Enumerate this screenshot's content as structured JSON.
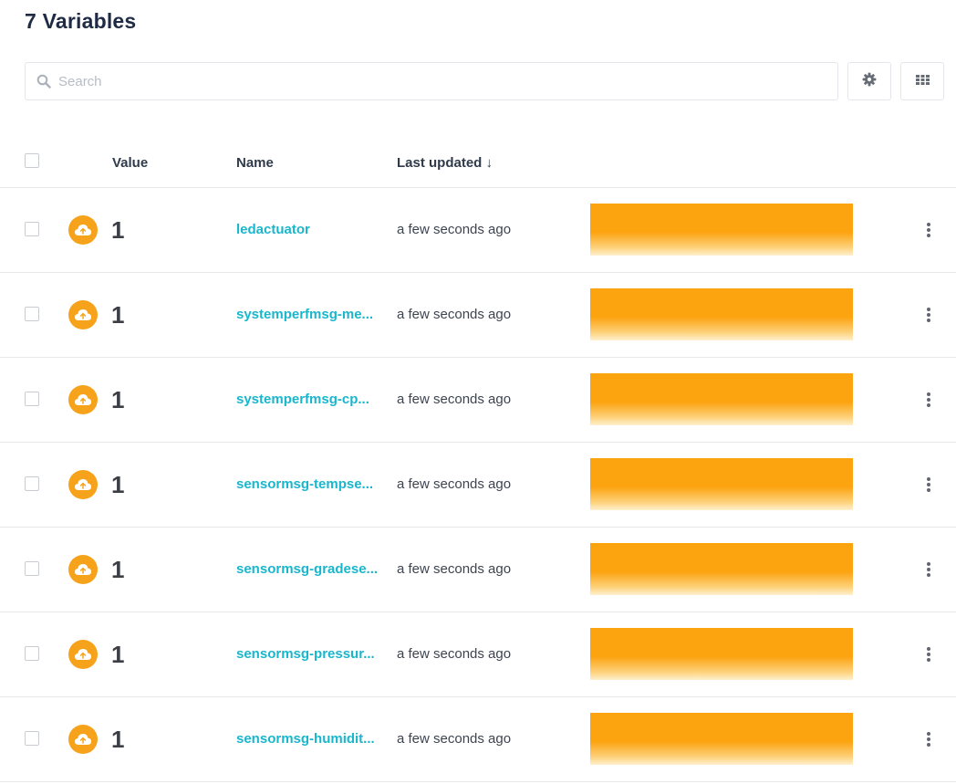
{
  "page": {
    "title": "7 Variables"
  },
  "search": {
    "placeholder": "Search",
    "icon": "search-icon"
  },
  "toolbar": {
    "settings_icon": "gear-icon",
    "grid_icon": "grid-icon"
  },
  "table": {
    "columns": {
      "value": "Value",
      "name": "Name",
      "last_updated": "Last updated ↓"
    },
    "rows": [
      {
        "icon": "cloud-upload-icon",
        "value": "1",
        "name": "ledactuator",
        "updated": "a few seconds ago"
      },
      {
        "icon": "cloud-upload-icon",
        "value": "1",
        "name": "systemperfmsg-me...",
        "updated": "a few seconds ago"
      },
      {
        "icon": "cloud-upload-icon",
        "value": "1",
        "name": "systemperfmsg-cp...",
        "updated": "a few seconds ago"
      },
      {
        "icon": "cloud-upload-icon",
        "value": "1",
        "name": "sensormsg-tempse...",
        "updated": "a few seconds ago"
      },
      {
        "icon": "cloud-upload-icon",
        "value": "1",
        "name": "sensormsg-gradese...",
        "updated": "a few seconds ago"
      },
      {
        "icon": "cloud-upload-icon",
        "value": "1",
        "name": "sensormsg-pressur...",
        "updated": "a few seconds ago"
      },
      {
        "icon": "cloud-upload-icon",
        "value": "1",
        "name": "sensormsg-humidit...",
        "updated": "a few seconds ago"
      }
    ]
  },
  "colors": {
    "accent_name": "#19b6cc",
    "status_orange": "#f6a31b",
    "sparkline": "#fca310"
  }
}
